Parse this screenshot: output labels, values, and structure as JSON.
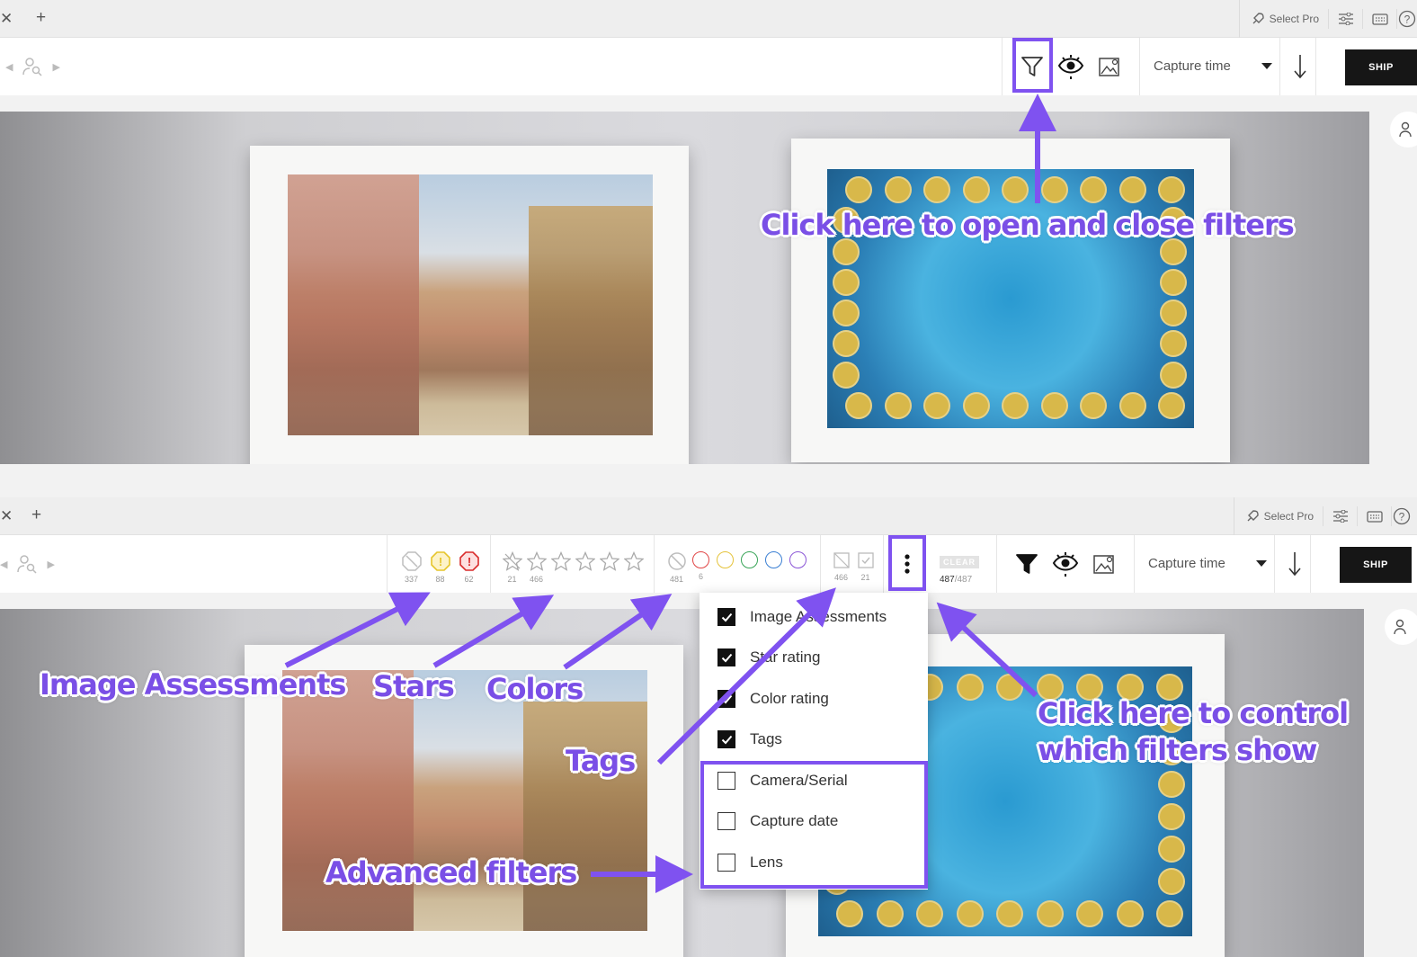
{
  "top": {
    "tabbar": {
      "close": "✕",
      "add": "+",
      "select_pro": "Select Pro"
    },
    "toolbar": {
      "sort_label": "Capture time",
      "ship_label": "SHIP"
    }
  },
  "bottom": {
    "tabbar": {
      "close": "✕",
      "add": "+",
      "select_pro": "Select Pro"
    },
    "toolbar": {
      "sort_label": "Capture time",
      "ship_label": "SHIP"
    },
    "filters": {
      "assessments": [
        {
          "icon": "rejected-icon",
          "count": "337",
          "color": "#bdbdbd"
        },
        {
          "icon": "warning-icon",
          "count": "88",
          "color": "#e6c52b"
        },
        {
          "icon": "error-icon",
          "count": "62",
          "color": "#d92b2b"
        }
      ],
      "stars": [
        {
          "icon": "star-icon",
          "count": "21"
        },
        {
          "icon": "star-icon",
          "count": "466"
        },
        {
          "icon": "star-icon",
          "count": ""
        },
        {
          "icon": "star-icon",
          "count": ""
        },
        {
          "icon": "star-icon",
          "count": ""
        },
        {
          "icon": "star-icon",
          "count": ""
        }
      ],
      "colors": [
        {
          "name": "none",
          "count": "481",
          "color": "#bdbdbd"
        },
        {
          "name": "red",
          "count": "6",
          "color": "#e04444"
        },
        {
          "name": "yellow",
          "count": "",
          "color": "#e5c33a"
        },
        {
          "name": "green",
          "count": "",
          "color": "#38a457"
        },
        {
          "name": "blue",
          "count": "",
          "color": "#3a7fd3"
        },
        {
          "name": "purple",
          "count": "",
          "color": "#8b56d6"
        }
      ],
      "tags": [
        {
          "icon": "untagged-icon",
          "count": "466"
        },
        {
          "icon": "tagged-icon",
          "count": "21"
        }
      ],
      "clear_label": "CLEAR",
      "total_shown": "487",
      "total": "/487"
    },
    "menu": {
      "items": [
        {
          "label": "Image Assessments",
          "checked": true
        },
        {
          "label": "Star rating",
          "checked": true
        },
        {
          "label": "Color rating",
          "checked": true
        },
        {
          "label": "Tags",
          "checked": true
        },
        {
          "label": "Camera/Serial",
          "checked": false
        },
        {
          "label": "Capture date",
          "checked": false
        },
        {
          "label": "Lens",
          "checked": false
        }
      ]
    }
  },
  "annotations": {
    "filters_toggle": "Click here to open and close filters",
    "image_assessments": "Image Assessments",
    "stars": "Stars",
    "colors": "Colors",
    "tags": "Tags",
    "advanced": "Advanced filters",
    "control_line1": "Click here to control",
    "control_line2": "which filters show",
    "accent_color": "#7f52f0"
  }
}
